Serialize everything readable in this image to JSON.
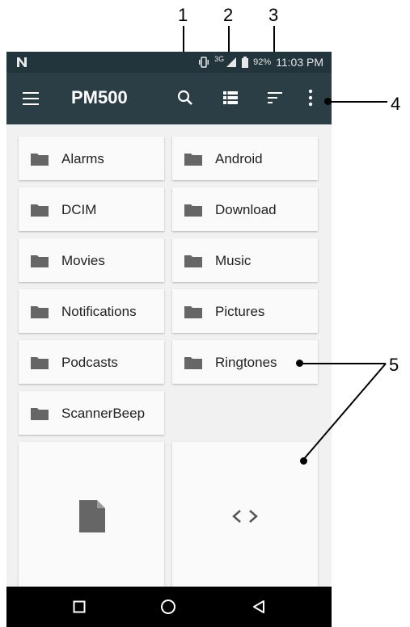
{
  "callouts": [
    "1",
    "2",
    "3",
    "4",
    "5"
  ],
  "status_bar": {
    "carrier_icon": "n-logo-icon",
    "network": "3G",
    "battery": "92%",
    "time": "11:03 PM"
  },
  "app_bar": {
    "title": "PM500",
    "icons": [
      "menu-icon",
      "search-icon",
      "list-view-icon",
      "sort-icon",
      "overflow-menu-icon"
    ]
  },
  "folders": [
    {
      "label": "Alarms"
    },
    {
      "label": "Android"
    },
    {
      "label": "DCIM"
    },
    {
      "label": "Download"
    },
    {
      "label": "Movies"
    },
    {
      "label": "Music"
    },
    {
      "label": "Notifications"
    },
    {
      "label": "Pictures"
    },
    {
      "label": "Podcasts"
    },
    {
      "label": "Ringtones"
    },
    {
      "label": "ScannerBeep"
    }
  ],
  "files": [
    {
      "icon": "document-icon"
    },
    {
      "icon": "code-icon"
    }
  ],
  "nav_bar": {
    "icons": [
      "recents-icon",
      "home-icon",
      "back-icon"
    ]
  },
  "colors": {
    "app_bar": "#2b3d45",
    "status_bar": "#22343c",
    "background": "#f1f1f1",
    "folder_icon": "#666666"
  }
}
